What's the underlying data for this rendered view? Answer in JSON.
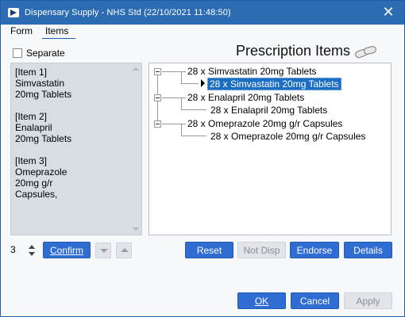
{
  "window": {
    "title": "Dispensary Supply - NHS Std (22/10/2021 11:48:50)",
    "close_glyph": "✕"
  },
  "tabs": [
    {
      "label": "Form"
    },
    {
      "label": "Items"
    }
  ],
  "separate_checkbox": {
    "label": "Separate",
    "checked": false
  },
  "heading": "Prescription Items",
  "left_items": [
    "[Item 1]\nSimvastatin\n20mg Tablets",
    "[Item 2]\nEnalapril\n20mg Tablets",
    "[Item 3]\nOmeprazole\n20mg g/r\nCapsules,"
  ],
  "tree": [
    {
      "label": "28 x Simvastatin 20mg Tablets",
      "child": "28 x Simvastatin 20mg Tablets",
      "selected": true
    },
    {
      "label": "28 x Enalapril 20mg Tablets",
      "child": "28 x Enalapril 20mg Tablets",
      "selected": false
    },
    {
      "label": "28 x Omeprazole 20mg g/r Capsules",
      "child": "28 x Omeprazole 20mg g/r Capsules",
      "selected": false
    }
  ],
  "quantity": "3",
  "buttons": {
    "confirm": "Confirm",
    "reset": "Reset",
    "not_disp": "Not Disp",
    "endorse": "Endorse",
    "details": "Details",
    "ok": "OK",
    "cancel": "Cancel",
    "apply": "Apply"
  },
  "colors": {
    "titlebar": "#2b6cb3",
    "button": "#2f6dd3",
    "selection": "#1b6ec2"
  }
}
